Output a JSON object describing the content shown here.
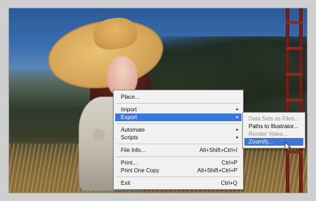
{
  "context_menu": {
    "items": [
      {
        "label": "Place...",
        "shortcut": "",
        "has_submenu": false
      },
      {
        "label": "Import",
        "shortcut": "",
        "has_submenu": true
      },
      {
        "label": "Export",
        "shortcut": "",
        "has_submenu": true,
        "state": "highlighted"
      },
      {
        "label": "Automate",
        "shortcut": "",
        "has_submenu": true
      },
      {
        "label": "Scripts",
        "shortcut": "",
        "has_submenu": true
      },
      {
        "label": "File Info...",
        "shortcut": "Alt+Shift+Ctrl+I",
        "has_submenu": false
      },
      {
        "label": "Print...",
        "shortcut": "Ctrl+P",
        "has_submenu": false
      },
      {
        "label": "Print One Copy",
        "shortcut": "Alt+Shift+Ctrl+P",
        "has_submenu": false
      },
      {
        "label": "Exit",
        "shortcut": "Ctrl+Q",
        "has_submenu": false
      }
    ]
  },
  "export_submenu": {
    "items": [
      {
        "label": "Data Sets as Files...",
        "state": "disabled"
      },
      {
        "label": "Paths to Illustrator...",
        "state": "enabled"
      },
      {
        "label": "Render Video...",
        "state": "disabled"
      },
      {
        "label": "Zoomify...",
        "state": "highlighted"
      }
    ]
  },
  "colors": {
    "highlight": "#3d76d6",
    "menu_bg": "#f1f1f1",
    "disabled_text": "#8f8f8f"
  },
  "icons": {
    "submenu_arrow": "chevron-right-icon",
    "cursor": "mouse-pointer-icon"
  }
}
